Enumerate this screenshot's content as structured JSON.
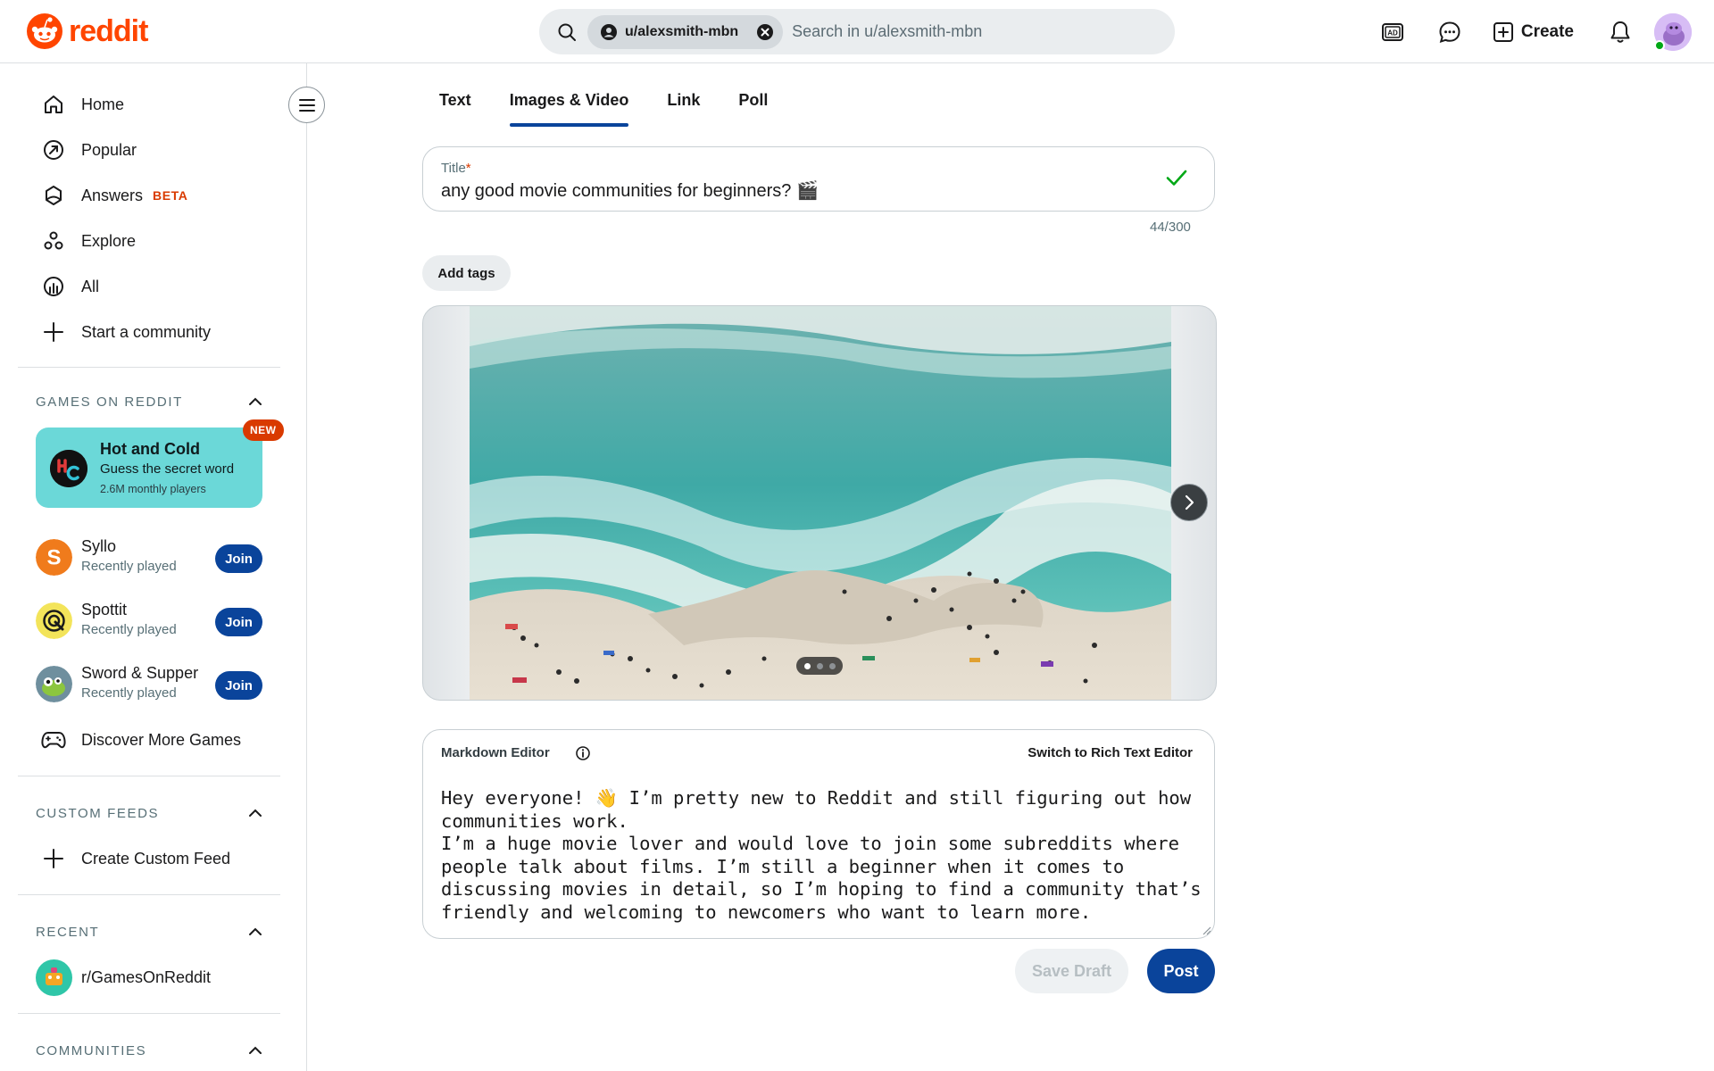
{
  "brand": {
    "name": "reddit",
    "color": "#ff4500"
  },
  "search": {
    "scope_chip": "u/alexsmith-mbn",
    "placeholder": "Search in u/alexsmith-mbn"
  },
  "header": {
    "icons": [
      "advertise-icon",
      "chat-icon",
      "create-icon",
      "notifications-icon"
    ],
    "create_label": "Create"
  },
  "sidebar": {
    "nav": [
      {
        "label": "Home",
        "icon": "home-icon"
      },
      {
        "label": "Popular",
        "icon": "popular-icon"
      },
      {
        "label": "Answers",
        "icon": "answers-icon",
        "badge": "BETA"
      },
      {
        "label": "Explore",
        "icon": "explore-icon"
      },
      {
        "label": "All",
        "icon": "all-icon"
      },
      {
        "label": "Start a community",
        "icon": "plus-icon"
      }
    ],
    "games_section": "GAMES ON REDDIT",
    "featured_game": {
      "title": "Hot and Cold",
      "subtitle": "Guess the secret word",
      "players": "2.6M monthly players",
      "badge": "NEW"
    },
    "games": [
      {
        "name": "Syllo",
        "status": "Recently played",
        "action": "Join"
      },
      {
        "name": "Spottit",
        "status": "Recently played",
        "action": "Join"
      },
      {
        "name": "Sword & Supper",
        "status": "Recently played",
        "action": "Join"
      }
    ],
    "discover_games": "Discover More Games",
    "custom_feeds_section": "CUSTOM FEEDS",
    "create_custom_feed": "Create Custom Feed",
    "recent_section": "RECENT",
    "recent_items": [
      {
        "label": "r/GamesOnReddit"
      }
    ],
    "communities_section": "COMMUNITIES"
  },
  "composer": {
    "tabs": [
      {
        "label": "Text",
        "active": false
      },
      {
        "label": "Images & Video",
        "active": true
      },
      {
        "label": "Link",
        "active": false
      },
      {
        "label": "Poll",
        "active": false
      }
    ],
    "title_label": "Title",
    "title_required_mark": "*",
    "title_value": "any good movie communities for beginners? 🎬",
    "char_count": "44/300",
    "add_tags": "Add tags",
    "carousel": {
      "total_images": 3,
      "current_index": 1
    },
    "editor_mode": "Markdown Editor",
    "switch_editor": "Switch to Rich Text Editor",
    "body": "Hey everyone! 👋 I’m pretty new to Reddit and still figuring out how\ncommunities work.\nI’m a huge movie lover and would love to join some subreddits where\npeople talk about films. I’m still a beginner when it comes to\ndiscussing movies in detail, so I’m hoping to find a community that’s\nfriendly and welcoming to newcomers who want to learn more.",
    "save_draft": "Save Draft",
    "post": "Post"
  },
  "colors": {
    "accent": "#0a449b",
    "brand": "#ff4500",
    "game_card": "#6bd8d8",
    "badge": "#d93a00"
  }
}
